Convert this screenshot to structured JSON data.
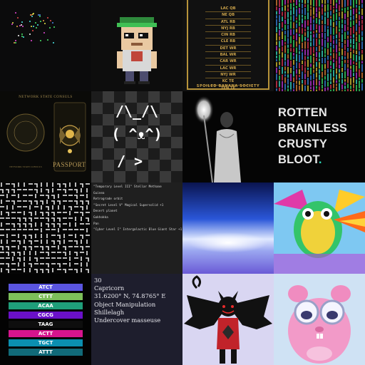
{
  "roster": {
    "rows": [
      "LAC QB",
      "NE QB",
      "ATL RB",
      "NYJ RB",
      "CIN RB",
      "CLE RB",
      "DET WR",
      "BAL WR",
      "CAR WR",
      "LAC WR",
      "NYJ WR",
      "KC TE",
      "TEN TE",
      "DET DST",
      "SF DST"
    ],
    "footer": "SPOILED BANANA SOCIETY"
  },
  "passport": {
    "header": "NETWORK STATE CONSULS",
    "label": "PASSPORT",
    "small": "NETWORK STATE CONSULS"
  },
  "cat": {
    "line1": "/\\_/\\",
    "line2": "( ^ᴥ^)",
    "line3": "/ >"
  },
  "words": {
    "lines": [
      "ROTTEN",
      "BRAINLESS",
      "CRUSTY",
      "BLOOT"
    ],
    "period": "."
  },
  "traits": {
    "lines": [
      "\"Temporary Level III\" Stellar Methane",
      "Guinea",
      "Retrograde orbit",
      "\"Secret Level V\" Magical Supersolid +1",
      "Desert planet",
      "Gokhokka",
      "Pan",
      "\"Cyber Level I\" Intergalactic Blue Giant Star +1"
    ]
  },
  "dna": {
    "bars": [
      {
        "label": "ATCT",
        "color": "#5a55e0"
      },
      {
        "label": "CTTT",
        "color": "#7dbf5a"
      },
      {
        "label": "ACAA",
        "color": "#1f9e7a"
      },
      {
        "label": "CGCG",
        "color": "#6a10c9"
      },
      {
        "label": "TAAG",
        "color": "#0e0e0e"
      },
      {
        "label": "ACTT",
        "color": "#d6148d"
      },
      {
        "label": "TGCT",
        "color": "#0b8fb0"
      },
      {
        "label": "ATTT",
        "color": "#116a78"
      }
    ]
  },
  "profile": {
    "lines": [
      "30",
      "Capricorn",
      "31.6200° N, 74.8765° E",
      "Object Manipulation",
      "Shillelagh",
      "Undercover masseuse"
    ]
  },
  "colors": {
    "gold": "#caa24a",
    "teal": "#2bd4b4"
  }
}
